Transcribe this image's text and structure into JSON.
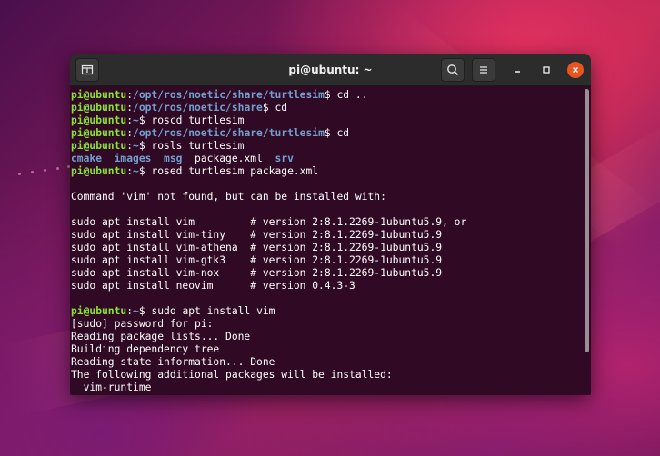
{
  "window": {
    "title": "pi@ubuntu: ~"
  },
  "titlebar": {
    "new_tab_icon": "new-tab-icon",
    "search_icon": "search-icon",
    "menu_icon": "hamburger-menu-icon",
    "minimize_icon": "minimize-icon",
    "maximize_icon": "maximize-icon",
    "close_icon": "close-icon"
  },
  "colors": {
    "user_host": "#8ae234",
    "path": "#729fcf",
    "background": "#300a24",
    "close": "#e95420"
  },
  "terminal": {
    "lines": [
      {
        "kind": "prompt",
        "user": "pi@ubuntu",
        "sep": ":",
        "path": "/opt/ros/noetic/share/turtlesim",
        "sym": "$ ",
        "cmd": "cd .."
      },
      {
        "kind": "prompt",
        "user": "pi@ubuntu",
        "sep": ":",
        "path": "/opt/ros/noetic/share",
        "sym": "$ ",
        "cmd": "cd"
      },
      {
        "kind": "prompt",
        "user": "pi@ubuntu",
        "sep": ":",
        "path": "~",
        "sym": "$ ",
        "cmd": "roscd turtlesim"
      },
      {
        "kind": "prompt",
        "user": "pi@ubuntu",
        "sep": ":",
        "path": "/opt/ros/noetic/share/turtlesim",
        "sym": "$ ",
        "cmd": "cd"
      },
      {
        "kind": "prompt",
        "user": "pi@ubuntu",
        "sep": ":",
        "path": "~",
        "sym": "$ ",
        "cmd": "rosls turtlesim"
      },
      {
        "kind": "dirs",
        "items": [
          {
            "t": "cmake",
            "dir": true
          },
          {
            "t": "  "
          },
          {
            "t": "images",
            "dir": true
          },
          {
            "t": "  "
          },
          {
            "t": "msg",
            "dir": true
          },
          {
            "t": "  package.xml  "
          },
          {
            "t": "srv",
            "dir": true
          }
        ]
      },
      {
        "kind": "prompt",
        "user": "pi@ubuntu",
        "sep": ":",
        "path": "~",
        "sym": "$ ",
        "cmd": "rosed turtlesim package.xml"
      },
      {
        "kind": "text",
        "text": ""
      },
      {
        "kind": "text",
        "text": "Command 'vim' not found, but can be installed with:"
      },
      {
        "kind": "text",
        "text": ""
      },
      {
        "kind": "text",
        "text": "sudo apt install vim         # version 2:8.1.2269-1ubuntu5.9, or"
      },
      {
        "kind": "text",
        "text": "sudo apt install vim-tiny    # version 2:8.1.2269-1ubuntu5.9"
      },
      {
        "kind": "text",
        "text": "sudo apt install vim-athena  # version 2:8.1.2269-1ubuntu5.9"
      },
      {
        "kind": "text",
        "text": "sudo apt install vim-gtk3    # version 2:8.1.2269-1ubuntu5.9"
      },
      {
        "kind": "text",
        "text": "sudo apt install vim-nox     # version 2:8.1.2269-1ubuntu5.9"
      },
      {
        "kind": "text",
        "text": "sudo apt install neovim      # version 0.4.3-3"
      },
      {
        "kind": "text",
        "text": ""
      },
      {
        "kind": "prompt",
        "user": "pi@ubuntu",
        "sep": ":",
        "path": "~",
        "sym": "$ ",
        "cmd": "sudo apt install vim"
      },
      {
        "kind": "text",
        "text": "[sudo] password for pi:"
      },
      {
        "kind": "text",
        "text": "Reading package lists... Done"
      },
      {
        "kind": "text",
        "text": "Building dependency tree"
      },
      {
        "kind": "text",
        "text": "Reading state information... Done"
      },
      {
        "kind": "text",
        "text": "The following additional packages will be installed:"
      },
      {
        "kind": "text",
        "text": "  vim-runtime"
      }
    ]
  }
}
